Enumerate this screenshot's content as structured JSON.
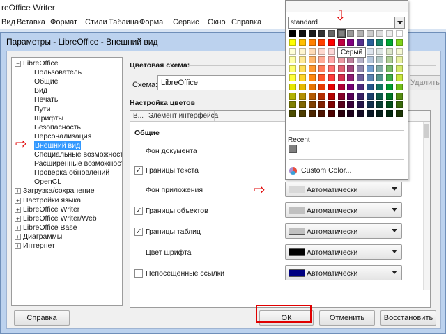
{
  "app": {
    "title": "reOffice Writer"
  },
  "menu": [
    "Вид",
    "Вставка",
    "Формат",
    "Стили",
    "Таблица",
    "Форма",
    "Сервис",
    "Окно",
    "Справка"
  ],
  "dialog": {
    "title": "Параметры - LibreOffice - Внешний вид",
    "tree": [
      {
        "label": "LibreOffice",
        "expander": "−",
        "level": 0
      },
      {
        "label": "Пользователь",
        "level": 1
      },
      {
        "label": "Общие",
        "level": 1
      },
      {
        "label": "Вид",
        "level": 1
      },
      {
        "label": "Печать",
        "level": 1
      },
      {
        "label": "Пути",
        "level": 1
      },
      {
        "label": "Шрифты",
        "level": 1
      },
      {
        "label": "Безопасность",
        "level": 1
      },
      {
        "label": "Персонализация",
        "level": 1
      },
      {
        "label": "Внешний вид",
        "level": 1,
        "selected": true
      },
      {
        "label": "Специальные возможности",
        "level": 1
      },
      {
        "label": "Расширенные возможности",
        "level": 1
      },
      {
        "label": "Проверка обновлений",
        "level": 1
      },
      {
        "label": "OpenCL",
        "level": 1
      },
      {
        "label": "Загрузка/сохранение",
        "expander": "+",
        "level": 0
      },
      {
        "label": "Настройки языка",
        "expander": "+",
        "level": 0
      },
      {
        "label": "LibreOffice Writer",
        "expander": "+",
        "level": 0
      },
      {
        "label": "LibreOffice Writer/Web",
        "expander": "+",
        "level": 0
      },
      {
        "label": "LibreOffice Base",
        "expander": "+",
        "level": 0
      },
      {
        "label": "Диаграммы",
        "expander": "+",
        "level": 0
      },
      {
        "label": "Интернет",
        "expander": "+",
        "level": 0
      }
    ],
    "scheme": {
      "section_title": "Цветовая схема:",
      "label": "Схема:",
      "value": "LibreOffice",
      "delete_label": "Удалить"
    },
    "colors": {
      "section_title": "Настройка цветов",
      "col_visible": "В...",
      "col_element": "Элемент интерфейса",
      "group_title": "Общие",
      "rows": [
        {
          "label": "Фон документа",
          "checkbox": false,
          "dropdown": null
        },
        {
          "label": "Границы текста",
          "checkbox": true,
          "dropdown": null
        },
        {
          "label": "Фон приложения",
          "checkbox": false,
          "dropdown": {
            "text": "Автоматически",
            "swatch": "#d8d8d8"
          }
        },
        {
          "label": "Границы объектов",
          "checkbox": true,
          "dropdown": {
            "text": "Автоматически",
            "swatch": "#c0c0c0"
          }
        },
        {
          "label": "Границы таблиц",
          "checkbox": true,
          "dropdown": {
            "text": "Автоматически",
            "swatch": "#c0c0c0"
          }
        },
        {
          "label": "Цвет шрифта",
          "checkbox": false,
          "dropdown": {
            "text": "Автоматически",
            "swatch": "#000000"
          }
        },
        {
          "label": "Непосещённые ссылки",
          "checkbox": true,
          "checked": false,
          "dropdown": {
            "text": "Автоматически",
            "swatch": "#000080"
          }
        }
      ]
    },
    "buttons": {
      "help": "Справка",
      "ok": "ОК",
      "cancel": "Отменить",
      "reset": "Восстановить"
    }
  },
  "popup": {
    "palette": "standard",
    "tooltip": "Серый",
    "recent_label": "Recent",
    "recent_color": "#808080",
    "custom_label": "Custom Color...",
    "highlighted_color": "#808080",
    "grid": [
      [
        "#000000",
        "#111111",
        "#1c1c1c",
        "#333333",
        "#666666",
        "#808080",
        "#999999",
        "#b2b2b2",
        "#cccccc",
        "#dddddd",
        "#eeeeee",
        "#ffffff"
      ],
      [
        "#ffff00",
        "#ffbf00",
        "#ff8000",
        "#ff4000",
        "#ff0000",
        "#bf0041",
        "#800080",
        "#55308d",
        "#2a6099",
        "#158466",
        "#00a933",
        "#81d41a"
      ],
      [
        "#ffffd7",
        "#fff5ce",
        "#ffdbb6",
        "#ffd8ce",
        "#ffd7d7",
        "#f7d1d5",
        "#e0c2cd",
        "#dedce6",
        "#dee6ef",
        "#dee7e5",
        "#dde8cb",
        "#f6f9d4"
      ],
      [
        "#ffffa6",
        "#ffe994",
        "#ffb66c",
        "#ffaa95",
        "#ffa6a6",
        "#ec9ba4",
        "#bf819e",
        "#b7b3ca",
        "#b4c7dc",
        "#b3cac7",
        "#afd095",
        "#e8f2a1"
      ],
      [
        "#ffff6d",
        "#ffde59",
        "#ff972f",
        "#ff7b59",
        "#ff6d6d",
        "#e16173",
        "#a1467e",
        "#8e86ae",
        "#729fcf",
        "#81aca6",
        "#77bc65",
        "#d4ea6b"
      ],
      [
        "#ffff38",
        "#ffd428",
        "#ff860d",
        "#ff5429",
        "#ff3838",
        "#d62e4e",
        "#8d1d75",
        "#6b5e9b",
        "#5983b0",
        "#50938a",
        "#3faf46",
        "#c9e73d"
      ],
      [
        "#e6e600",
        "#e6b800",
        "#e67300",
        "#e63900",
        "#e60000",
        "#b00037",
        "#730073",
        "#4c2a7d",
        "#245689",
        "#127460",
        "#009b2e",
        "#72be18"
      ],
      [
        "#b2b200",
        "#b28f00",
        "#b25900",
        "#b22d00",
        "#b20000",
        "#840029",
        "#560056",
        "#392063",
        "#1c406b",
        "#0e5a48",
        "#007526",
        "#568d11"
      ],
      [
        "#808000",
        "#806600",
        "#804000",
        "#802000",
        "#800000",
        "#58001c",
        "#390039",
        "#26154a",
        "#13304d",
        "#093d32",
        "#004e1a",
        "#396b0b"
      ],
      [
        "#4d4d00",
        "#4d3d00",
        "#4d2600",
        "#4d1300",
        "#4d0000",
        "#2b000e",
        "#1c001c",
        "#130b25",
        "#091826",
        "#051e19",
        "#00270d",
        "#1c3605"
      ]
    ]
  }
}
